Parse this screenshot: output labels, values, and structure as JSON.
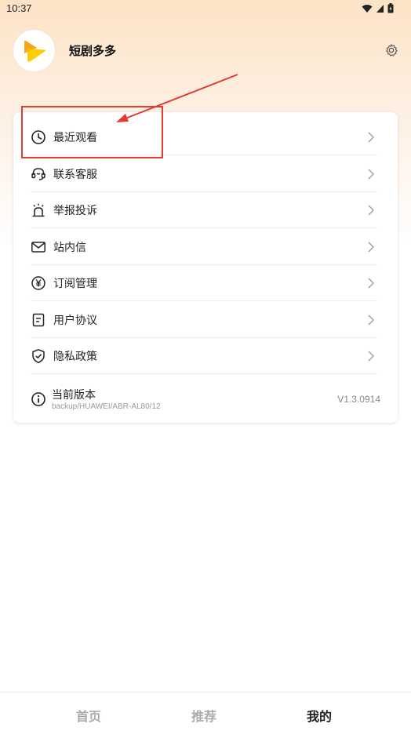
{
  "status_bar": {
    "time": "10:37"
  },
  "header": {
    "app_name": "短剧多多"
  },
  "menu": {
    "items": [
      {
        "label": "最近观看",
        "icon": "clock-icon"
      },
      {
        "label": "联系客服",
        "icon": "headset-icon"
      },
      {
        "label": "举报投诉",
        "icon": "alarm-icon"
      },
      {
        "label": "站内信",
        "icon": "mail-icon"
      },
      {
        "label": "订阅管理",
        "icon": "yen-circle-icon"
      },
      {
        "label": "用户协议",
        "icon": "document-icon"
      },
      {
        "label": "隐私政策",
        "icon": "shield-check-icon"
      }
    ],
    "version": {
      "label": "当前版本",
      "sub": "backup/HUAWEI/ABR-AL80/12",
      "value": "V1.3.0914"
    }
  },
  "bottom_nav": {
    "tabs": [
      {
        "label": "首页",
        "active": false
      },
      {
        "label": "推荐",
        "active": false
      },
      {
        "label": "我的",
        "active": true
      }
    ]
  },
  "colors": {
    "annotation": "#e33b32",
    "logo_orange": "#f7a41d",
    "logo_yellow": "#fcd000"
  }
}
